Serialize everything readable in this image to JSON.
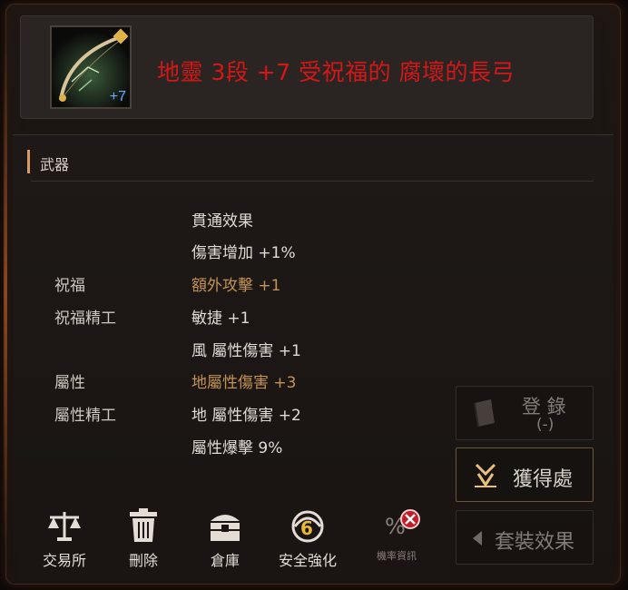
{
  "item": {
    "name": "地靈 3段 +7 受祝福的 腐壞的長弓",
    "enhance_badge": "+7",
    "icon": "longbow-icon"
  },
  "category": {
    "label": "武器"
  },
  "stats": [
    {
      "name": "",
      "value": "貫通效果",
      "color": "white"
    },
    {
      "name": "",
      "value": "傷害增加 +1%",
      "color": "white"
    },
    {
      "name": "祝福",
      "value": "額外攻擊 +1",
      "color": "gold"
    },
    {
      "name": "祝福精工",
      "value": "敏捷 +1",
      "color": "white"
    },
    {
      "name": "",
      "value": "風 屬性傷害 +1",
      "color": "white"
    },
    {
      "name": "屬性",
      "value": "地屬性傷害 +3",
      "color": "gold"
    },
    {
      "name": "屬性精工",
      "value": "地 屬性傷害 +2",
      "color": "white"
    },
    {
      "name": "",
      "value": "屬性爆擊 9%",
      "color": "white"
    }
  ],
  "side_buttons": {
    "register": {
      "line1": "登 錄",
      "line2": "(-)"
    },
    "source": {
      "label": "獲得處"
    },
    "set_effect": {
      "label": "套裝效果"
    }
  },
  "toolbar": {
    "exchange": "交易所",
    "delete": "刪除",
    "warehouse": "倉庫",
    "safe_enhance": "安全強化",
    "safe_enhance_badge": "6",
    "rate_label": "機率資訊"
  },
  "colors": {
    "item_name": "#d51717",
    "gold_stat": "#c39254",
    "white_stat": "#e0dad3",
    "enhance_badge": "#6aa8ff"
  }
}
